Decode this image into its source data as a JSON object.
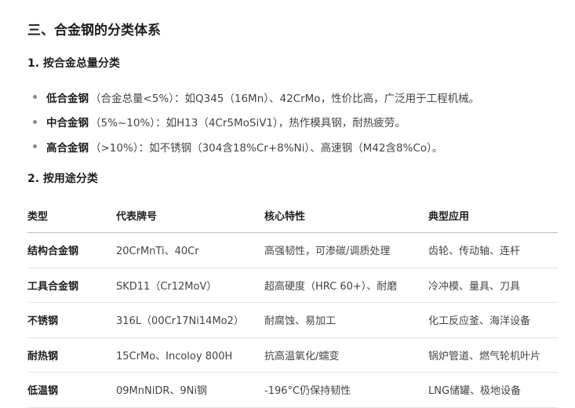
{
  "section_title": "三、合金钢的分类体系",
  "sub1_title": "1. 按合金总量分类",
  "bullets": [
    {
      "label": "低合金钢",
      "text": "（合金总量<5%）：如Q345（16Mn）、42CrMo，性价比高，广泛用于工程机械。"
    },
    {
      "label": "中合金钢",
      "text": "（5%~10%）：如H13（4Cr5MoSiV1），热作模具钢，耐热疲劳。"
    },
    {
      "label": "高合金钢",
      "text": "（>10%）：如不锈钢（304含18%Cr+8%Ni）、高速钢（M42含8%Co）。"
    }
  ],
  "sub2_title": "2. 按用途分类",
  "table": {
    "headers": [
      "类型",
      "代表牌号",
      "核心特性",
      "典型应用"
    ],
    "rows": [
      [
        "结构合金钢",
        "20CrMnTi、40Cr",
        "高强韧性，可渗碳/调质处理",
        "齿轮、传动轴、连杆"
      ],
      [
        "工具合金钢",
        "SKD11（Cr12MoV）",
        "超高硬度（HRC 60+）、耐磨",
        "冷冲模、量具、刀具"
      ],
      [
        "不锈钢",
        "316L（00Cr17Ni14Mo2）",
        "耐腐蚀、易加工",
        "化工反应釜、海洋设备"
      ],
      [
        "耐热钢",
        "15CrMo、Incoloy 800H",
        "抗高温氧化/蠕变",
        "锅炉管道、燃气轮机叶片"
      ],
      [
        "低温钢",
        "09MnNiDR、9Ni钢",
        "-196°C仍保持韧性",
        "LNG储罐、极地设备"
      ]
    ]
  }
}
